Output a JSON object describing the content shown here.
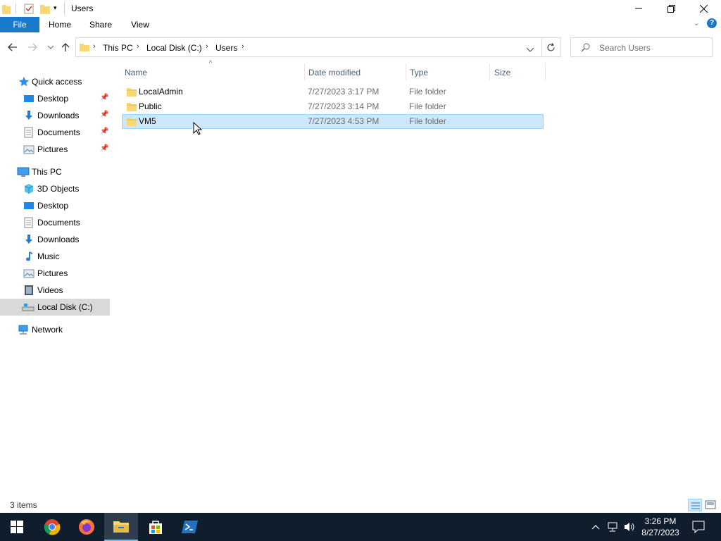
{
  "window": {
    "title": "Users"
  },
  "ribbon": {
    "file": "File",
    "home": "Home",
    "share": "Share",
    "view": "View"
  },
  "breadcrumb": [
    "This PC",
    "Local Disk (C:)",
    "Users"
  ],
  "search": {
    "placeholder": "Search Users"
  },
  "sidebar": {
    "quick_access": "Quick access",
    "quick_items": [
      "Desktop",
      "Downloads",
      "Documents",
      "Pictures"
    ],
    "this_pc": "This PC",
    "pc_items": [
      "3D Objects",
      "Desktop",
      "Documents",
      "Downloads",
      "Music",
      "Pictures",
      "Videos",
      "Local Disk (C:)"
    ],
    "network": "Network"
  },
  "columns": {
    "name": "Name",
    "date": "Date modified",
    "type": "Type",
    "size": "Size"
  },
  "files": [
    {
      "name": "LocalAdmin",
      "date": "7/27/2023 3:17 PM",
      "type": "File folder"
    },
    {
      "name": "Public",
      "date": "7/27/2023 3:14 PM",
      "type": "File folder"
    },
    {
      "name": "VM5",
      "date": "7/27/2023 4:53 PM",
      "type": "File folder"
    }
  ],
  "status": {
    "items": "3 items"
  },
  "clock": {
    "time": "3:26 PM",
    "date": "8/27/2023"
  },
  "colors": {
    "accent": "#1979ca",
    "selection": "#cce8ff",
    "taskbar": "#0f1d2c"
  }
}
